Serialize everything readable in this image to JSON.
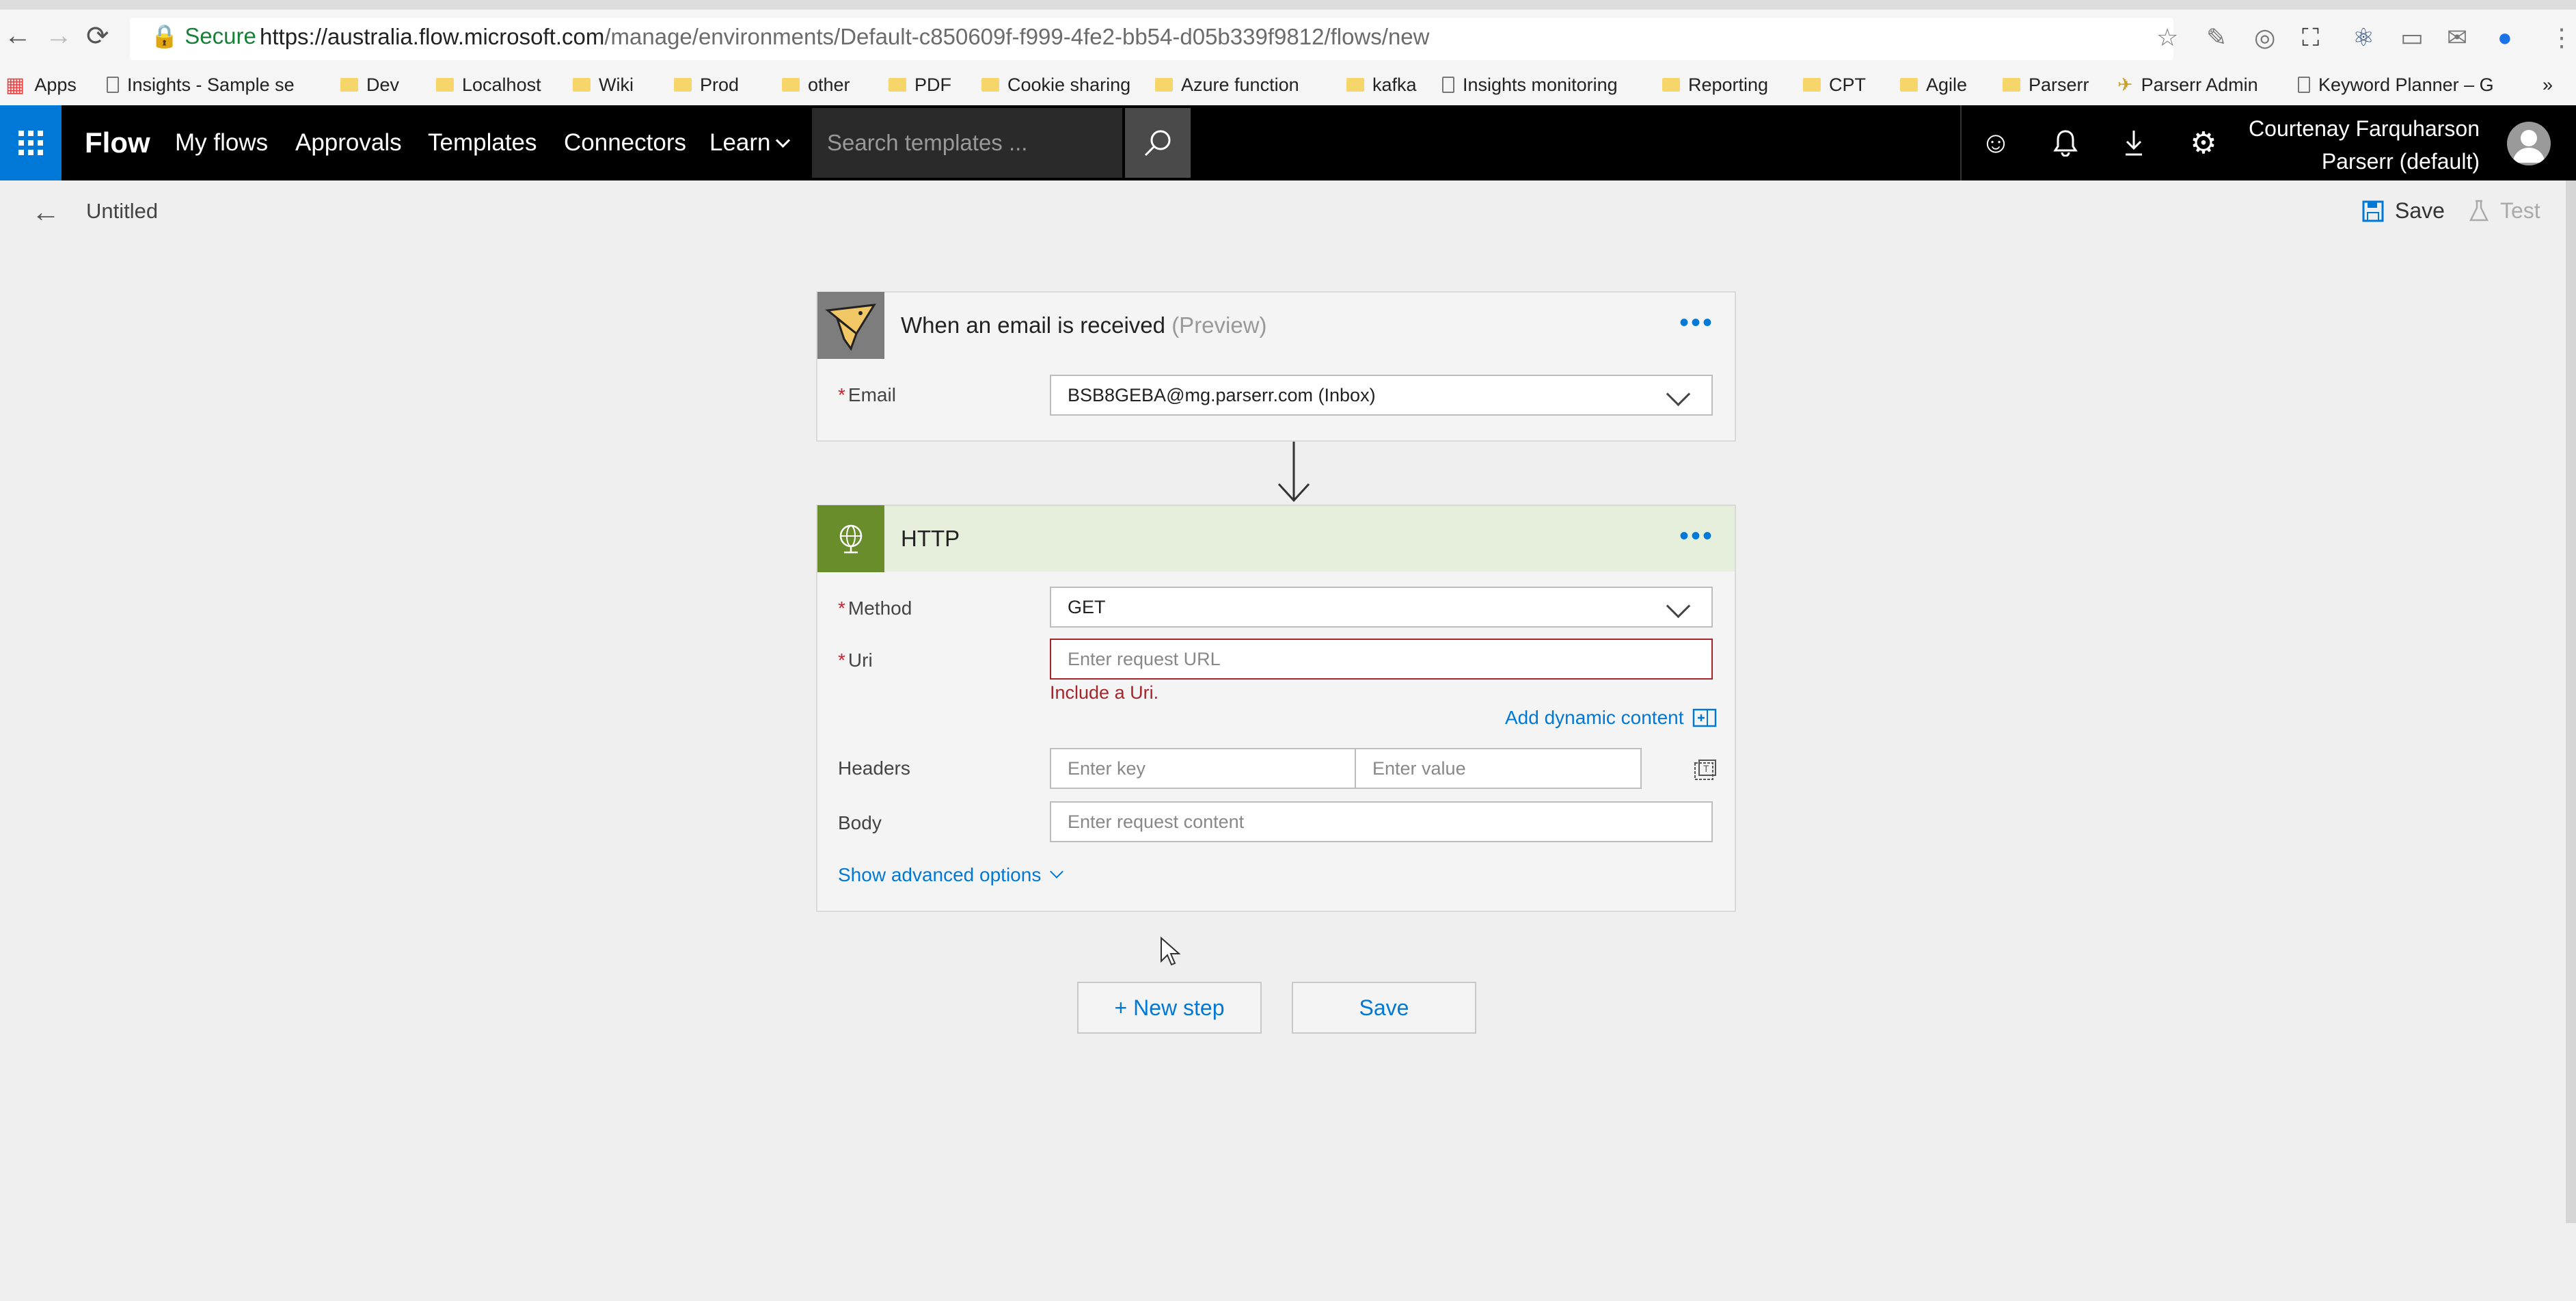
{
  "browser": {
    "secure_label": "Secure",
    "url_host": "https://australia.flow.microsoft.com",
    "url_path": "/manage/environments/Default-c850609f-f999-4fe2-bb54-d05b339f9812/flows/new",
    "bookmarks": [
      "Apps",
      "Insights - Sample se",
      "Dev",
      "Localhost",
      "Wiki",
      "Prod",
      "other",
      "PDF",
      "Cookie sharing",
      "Azure function",
      "kafka",
      "Insights monitoring",
      "Reporting",
      "CPT",
      "Agile",
      "Parserr",
      "Parserr Admin",
      "Keyword Planner – G"
    ]
  },
  "header": {
    "brand": "Flow",
    "nav": [
      "My flows",
      "Approvals",
      "Templates",
      "Connectors",
      "Learn"
    ],
    "search_placeholder": "Search templates ...",
    "user_name": "Courtenay Farquharson",
    "environment": "Parserr (default)"
  },
  "titlebar": {
    "flow_name": "Untitled",
    "save_label": "Save",
    "test_label": "Test"
  },
  "trigger": {
    "title": "When an email is received",
    "preview_tag": "(Preview)",
    "email_label": "Email",
    "email_value": "BSB8GEBA@mg.parserr.com (Inbox)",
    "accent_color": "#7d7d7d"
  },
  "http": {
    "title": "HTTP",
    "method_label": "Method",
    "method_value": "GET",
    "uri_label": "Uri",
    "uri_placeholder": "Enter request URL",
    "uri_error": "Include a Uri.",
    "dynamic_content_label": "Add dynamic content",
    "headers_label": "Headers",
    "header_key_placeholder": "Enter key",
    "header_value_placeholder": "Enter value",
    "body_label": "Body",
    "body_placeholder": "Enter request content",
    "advanced_label": "Show advanced options",
    "accent_color": "#6a8d2b",
    "header_bg": "#e6eedc"
  },
  "actions": {
    "new_step_label": "+ New step",
    "save_label": "Save"
  },
  "colors": {
    "link_blue": "#0078d7",
    "error_red": "#a4262c",
    "waffle_blue": "#0078d7"
  }
}
